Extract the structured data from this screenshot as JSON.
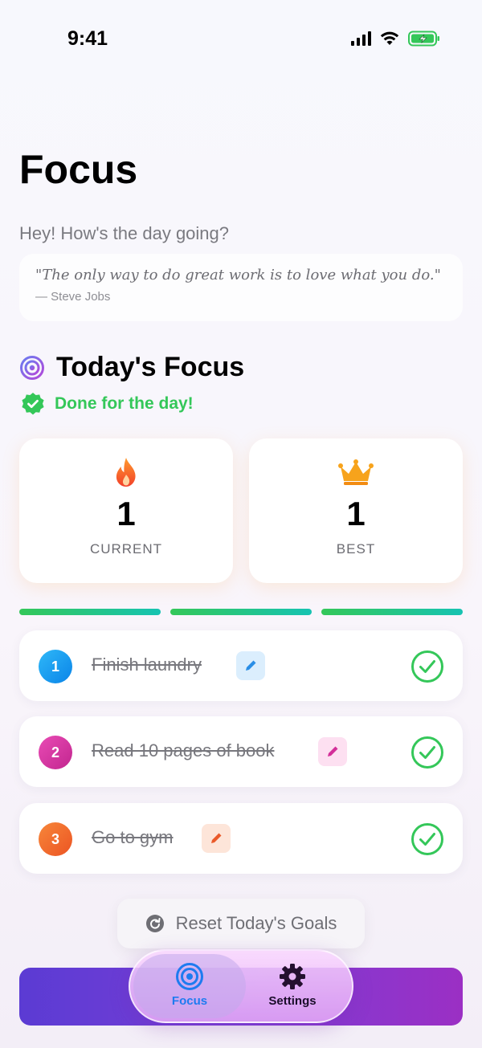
{
  "status_bar": {
    "time": "9:41"
  },
  "header": {
    "title": "Focus",
    "greeting": "Hey! How's the day going?"
  },
  "quote": {
    "text": "\"The only way to do great work is to love what you do.\"",
    "author": "— Steve Jobs"
  },
  "today": {
    "title": "Today's Focus",
    "status": "Done for the day!"
  },
  "stats": {
    "current": {
      "value": "1",
      "label": "CURRENT"
    },
    "best": {
      "value": "1",
      "label": "BEST"
    }
  },
  "progress": {
    "completed": 3,
    "total": 3
  },
  "goals": [
    {
      "number": "1",
      "text": "Finish laundry",
      "done": true,
      "color": "#1aa3f5"
    },
    {
      "number": "2",
      "text": "Read 10 pages of book",
      "done": true,
      "color": "#d92fa2"
    },
    {
      "number": "3",
      "text": "Go to gym",
      "done": true,
      "color": "#f26a2e"
    }
  ],
  "reset_button": {
    "label": "Reset Today's Goals"
  },
  "tabs": [
    {
      "label": "Focus",
      "icon": "target-icon",
      "active": true
    },
    {
      "label": "Settings",
      "icon": "gear-icon",
      "active": false
    }
  ],
  "colors": {
    "accent_green": "#34c759",
    "tab_active_blue": "#1e7bf0",
    "bottom_bar": "#7a3ed6"
  }
}
